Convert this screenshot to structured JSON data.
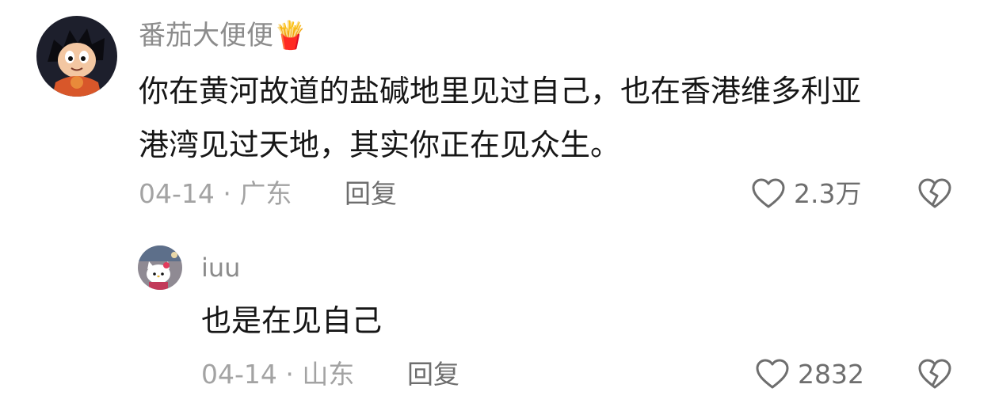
{
  "comments": [
    {
      "username": "番茄大便便🍟",
      "text_line1": "你在黄河故道的盐碱地里见过自己，也在香港维多利亚",
      "text_line2": "港湾见过天地，其实你正在见众生。",
      "meta": "04-14 · 广东",
      "reply_label": "回复",
      "likes": "2.3万",
      "avatar_icon": "cartoon-boy-avatar"
    },
    {
      "username": "iuu",
      "text": "也是在见自己",
      "meta": "04-14 · 山东",
      "reply_label": "回复",
      "likes": "2832",
      "avatar_icon": "hello-kitty-avatar"
    }
  ],
  "icons": {
    "like": "heart-outline-icon",
    "dislike": "broken-heart-icon"
  },
  "colors": {
    "username": "#8c8c8c",
    "text": "#161616",
    "meta": "#a3a3a3",
    "action": "#6e6e6e"
  }
}
